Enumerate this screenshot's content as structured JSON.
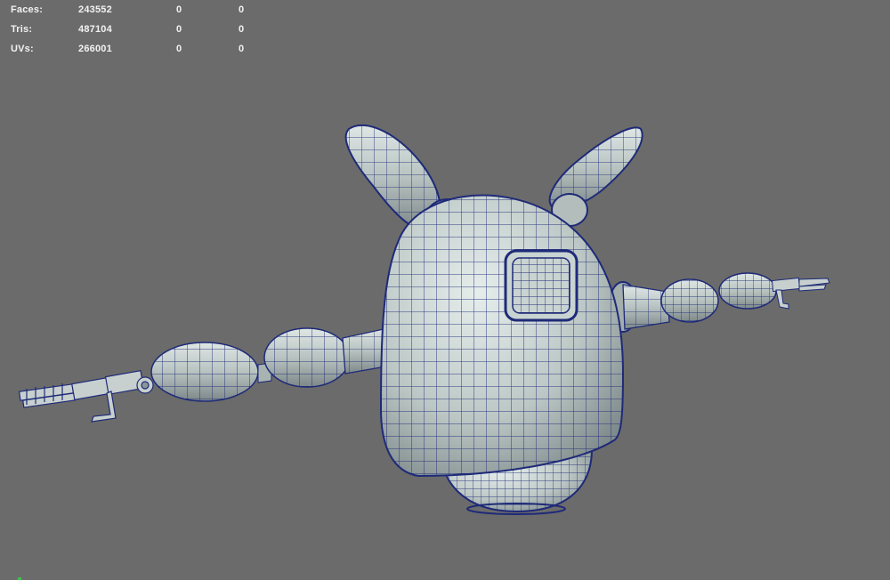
{
  "heads_up_display": {
    "rows": [
      {
        "label": "Faces:",
        "total": "243552",
        "selected": "0",
        "extra": "0"
      },
      {
        "label": "Tris:",
        "total": "487104",
        "selected": "0",
        "extra": "0"
      },
      {
        "label": "UVs:",
        "total": "266001",
        "selected": "0",
        "extra": "0"
      }
    ]
  },
  "viewport": {
    "background_color": "#6b6b6b",
    "wire_color": "#1e2a78",
    "shade_color": "#c8d2d0"
  }
}
